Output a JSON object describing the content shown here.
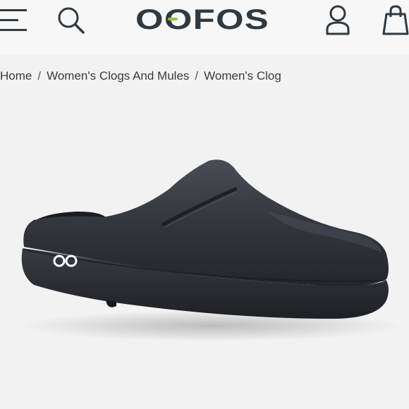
{
  "header": {
    "logo_text": "OOFOS",
    "icons": [
      "hamburger-menu-icon",
      "search-icon",
      "account-icon",
      "shopping-bag-icon"
    ],
    "logo_accent_color": "#8dc63f",
    "text_color": "#30393f"
  },
  "breadcrumb": {
    "items": [
      "Home",
      "Women's Clogs And Mules",
      "Women's Clog"
    ],
    "separator": "/"
  },
  "product": {
    "badge_text": "OO",
    "shoe_color": "#2f3138"
  }
}
